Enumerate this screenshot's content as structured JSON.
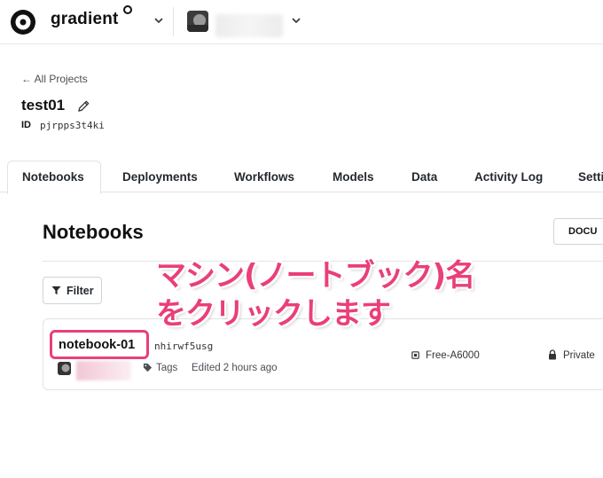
{
  "header": {
    "brand": "gradient",
    "account_name": ""
  },
  "project": {
    "back_link": "← All Projects",
    "title": "test01",
    "id_label": "ID",
    "id_value": "pjrpps3t4ki"
  },
  "tabs": [
    {
      "label": "Notebooks",
      "active": true
    },
    {
      "label": "Deployments"
    },
    {
      "label": "Workflows"
    },
    {
      "label": "Models"
    },
    {
      "label": "Data"
    },
    {
      "label": "Activity Log"
    },
    {
      "label": "Setti"
    }
  ],
  "notebooks": {
    "title": "Notebooks",
    "docs_button": "DOCU",
    "filter_label": "Filter",
    "items": [
      {
        "name": "notebook-01",
        "id": "nhirwf5usg",
        "tags_label": "Tags",
        "edited": "Edited 2 hours ago",
        "machine": "Free-A6000",
        "privacy": "Private"
      }
    ]
  },
  "annotation": {
    "line1": "マシン(ノートブック)名",
    "line2": "をクリックします",
    "color": "#ea3f78"
  },
  "icons": [
    "gradient-logo-icon",
    "chevron-down-icon",
    "pencil-icon",
    "filter-icon",
    "tag-icon",
    "chip-icon",
    "lock-icon"
  ]
}
